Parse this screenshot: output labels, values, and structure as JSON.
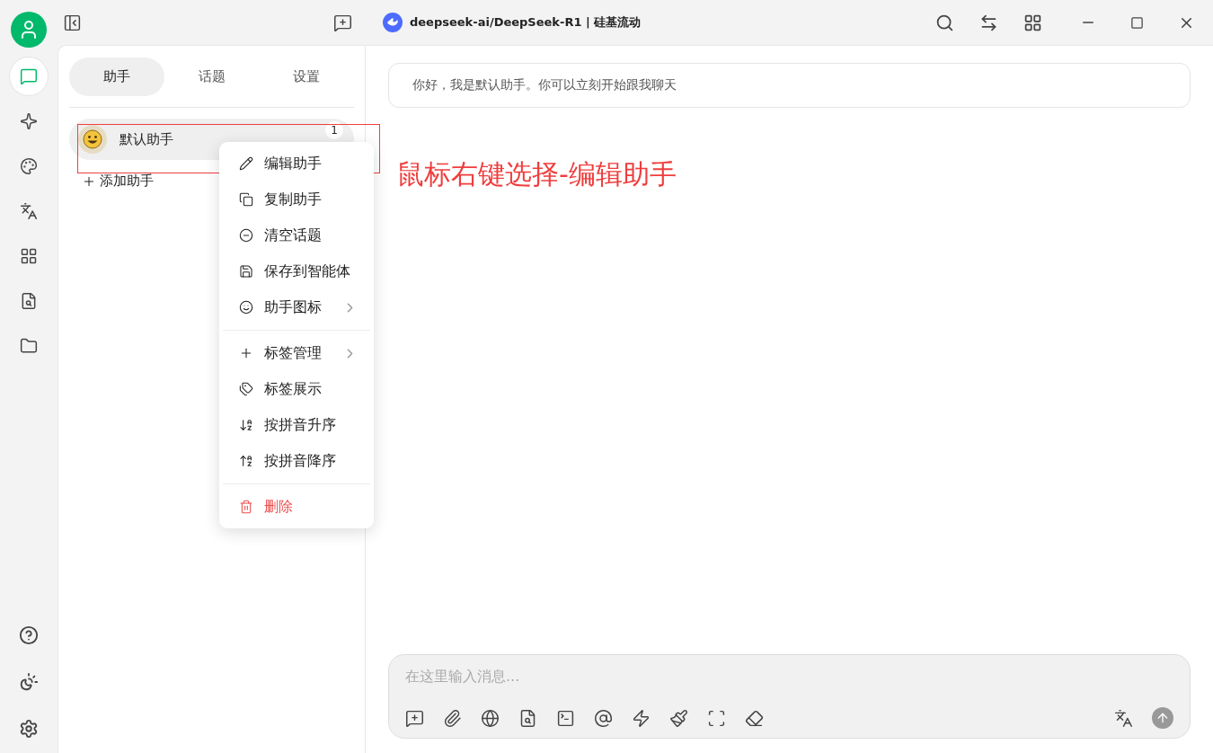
{
  "window": {
    "title": "deepseek-ai/DeepSeek-R1 | 硅基流动"
  },
  "rail": {
    "items": [
      {
        "selected": true
      },
      {
        "selected": false
      },
      {
        "selected": false
      },
      {
        "selected": false
      },
      {
        "selected": false
      },
      {
        "selected": false
      },
      {
        "selected": false
      }
    ]
  },
  "tabs": [
    {
      "label": "助手",
      "selected": true
    },
    {
      "label": "话题",
      "selected": false
    },
    {
      "label": "设置",
      "selected": false
    }
  ],
  "assistants": [
    {
      "name": "默认助手",
      "count": "1",
      "selected": true
    }
  ],
  "add_assistant": "添加助手",
  "context_menu": {
    "groups": [
      [
        {
          "label": "编辑助手",
          "submenu": false,
          "kind": "normal"
        },
        {
          "label": "复制助手",
          "submenu": false,
          "kind": "normal"
        },
        {
          "label": "清空话题",
          "submenu": false,
          "kind": "normal"
        },
        {
          "label": "保存到智能体",
          "submenu": false,
          "kind": "normal"
        },
        {
          "label": "助手图标",
          "submenu": true,
          "kind": "normal"
        }
      ],
      [
        {
          "label": "标签管理",
          "submenu": true,
          "kind": "normal"
        },
        {
          "label": "标签展示",
          "submenu": false,
          "kind": "normal"
        },
        {
          "label": "按拼音升序",
          "submenu": false,
          "kind": "normal"
        },
        {
          "label": "按拼音降序",
          "submenu": false,
          "kind": "normal"
        }
      ],
      [
        {
          "label": "删除",
          "submenu": false,
          "kind": "danger"
        }
      ]
    ]
  },
  "annotation": {
    "text": "鼠标右键选择-编辑助手"
  },
  "chat": {
    "greeting": "你好，我是默认助手。你可以立刻开始跟我聊天"
  },
  "composer": {
    "placeholder": "在这里输入消息..."
  }
}
